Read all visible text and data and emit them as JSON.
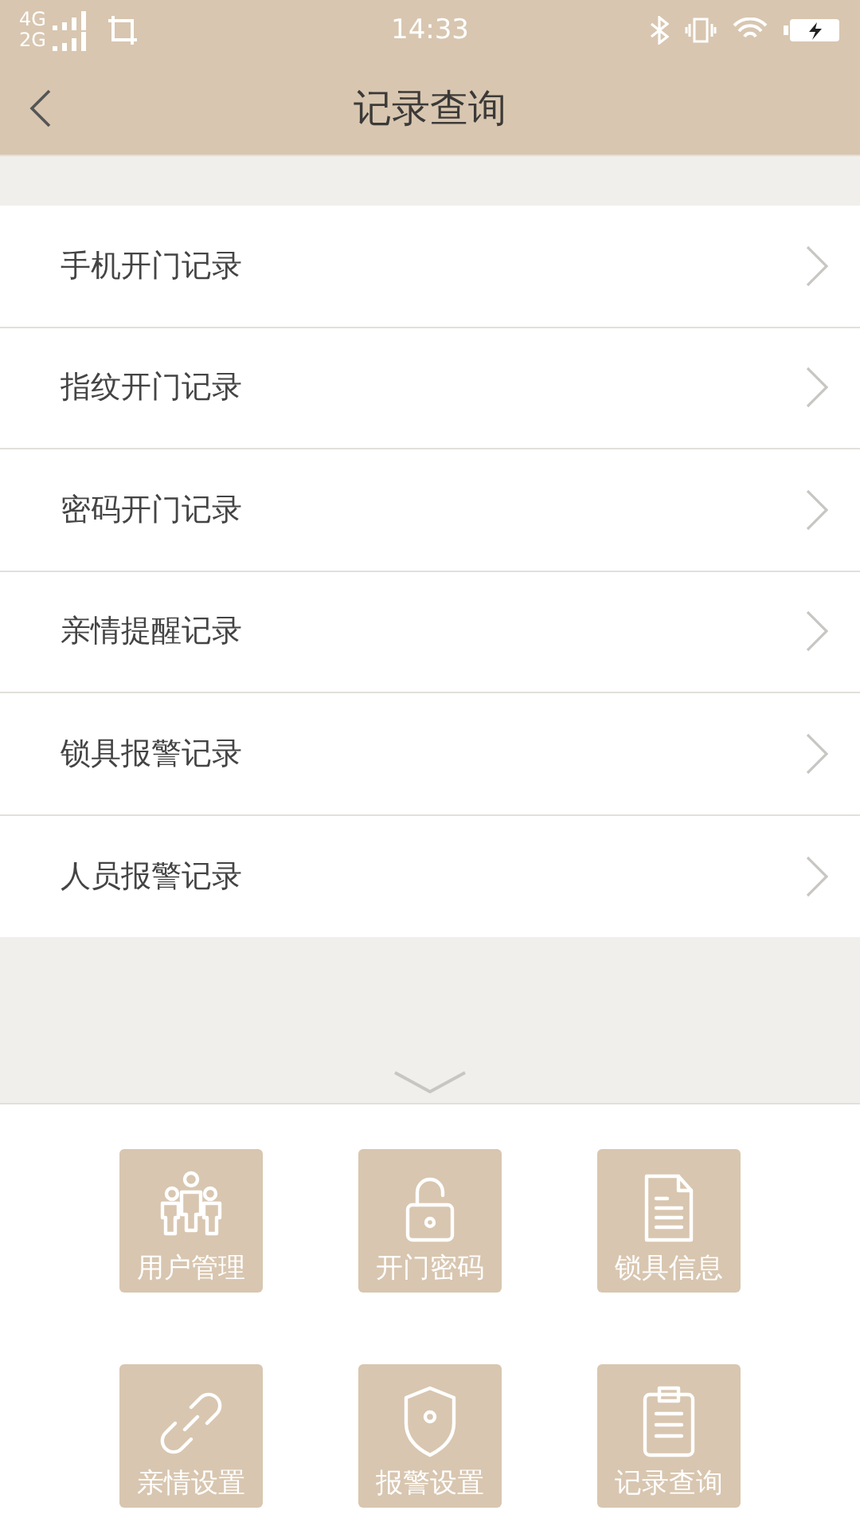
{
  "status_bar": {
    "networks": [
      "4G",
      "2G"
    ],
    "time": "14:33"
  },
  "header": {
    "title": "记录查询"
  },
  "records": [
    {
      "label": "手机开门记录"
    },
    {
      "label": "指纹开门记录"
    },
    {
      "label": "密码开门记录"
    },
    {
      "label": "亲情提醒记录"
    },
    {
      "label": "锁具报警记录"
    },
    {
      "label": "人员报警记录"
    }
  ],
  "menu": [
    {
      "kind": "users",
      "label": "用户管理"
    },
    {
      "kind": "unlock",
      "label": "开门密码"
    },
    {
      "kind": "document",
      "label": "锁具信息"
    },
    {
      "kind": "link",
      "label": "亲情设置"
    },
    {
      "kind": "shield",
      "label": "报警设置"
    },
    {
      "kind": "clipboard",
      "label": "记录查询"
    }
  ]
}
